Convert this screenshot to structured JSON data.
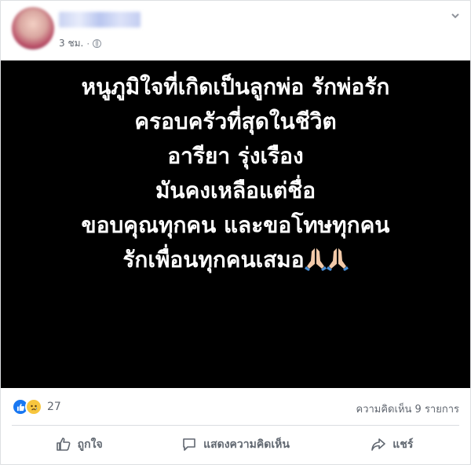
{
  "post": {
    "timestamp": "3 ชม.",
    "separator": "·",
    "privacy_icon": "globe-icon",
    "menu_icon": "chevron-down-icon",
    "image_text_lines": [
      "หนูภูมิใจที่เกิดเป็นลูกพ่อ รักพ่อรัก",
      "ครอบครัวที่สุดในชีวิต",
      "อารียา รุ่งเรือง",
      "มันคงเหลือแต่ชื่อ",
      "ขอบคุณทุกคน และขอโทษทุกคน",
      "รักเพื่อนทุกคนเสมอ"
    ],
    "image_background": "#000000",
    "emoji": "folded-hands"
  },
  "reactions": {
    "types": [
      "like",
      "sad"
    ],
    "count": "27"
  },
  "comments": {
    "label": "ความคิดเห็น 9 รายการ"
  },
  "actions": {
    "like_label": "ถูกใจ",
    "comment_label": "แสดงความคิดเห็น",
    "share_label": "แชร์"
  },
  "colors": {
    "like_blue": "#1877f2",
    "sad_yellow": "#f7c63e",
    "text_gray": "#606770"
  }
}
